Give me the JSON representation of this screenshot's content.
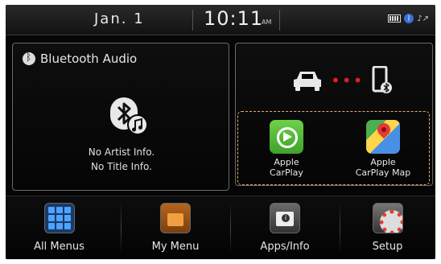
{
  "status_bar": {
    "date": "Jan.  1",
    "time": "10:11",
    "ampm": "AM"
  },
  "bluetooth_panel": {
    "title": "Bluetooth Audio",
    "artist_info": "No Artist Info.",
    "title_info": "No Title Info."
  },
  "carplay": {
    "apps": [
      {
        "label_line1": "Apple",
        "label_line2": "CarPlay"
      },
      {
        "label_line1": "Apple",
        "label_line2": "CarPlay Map"
      }
    ]
  },
  "menu": {
    "items": [
      {
        "label": "All Menus",
        "icon": "grid-icon"
      },
      {
        "label": "My Menu",
        "icon": "folder-icon"
      },
      {
        "label": "Apps/Info",
        "icon": "info-icon"
      },
      {
        "label": "Setup",
        "icon": "gear-icon"
      }
    ]
  },
  "colors": {
    "carplay_highlight": "#e0b060",
    "connection_dots": "#e02020",
    "carplay_green": "#4caf50"
  }
}
